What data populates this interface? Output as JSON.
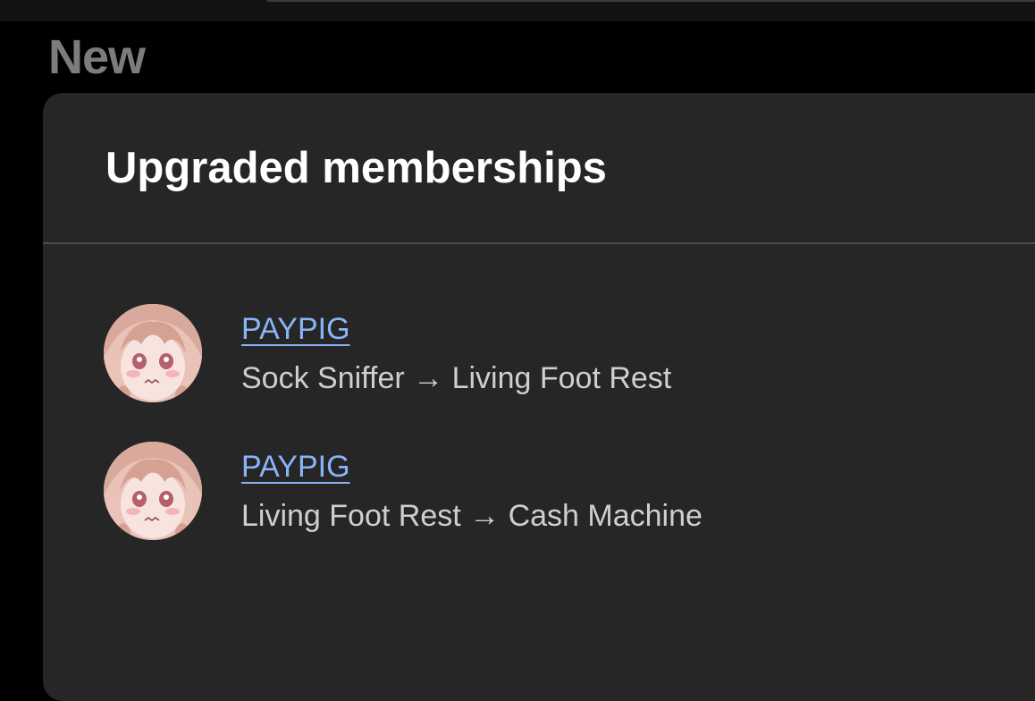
{
  "header": {
    "section_label": "New"
  },
  "card": {
    "title": "Upgraded memberships",
    "items": [
      {
        "name": "PAYPIG",
        "change": "Sock Sniffer → Living Foot Rest",
        "avatar_icon": "anime-avatar"
      },
      {
        "name": "PAYPIG",
        "change": "Living Foot Rest → Cash Machine",
        "avatar_icon": "anime-avatar"
      }
    ]
  },
  "colors": {
    "background": "#000000",
    "card": "#262626",
    "title": "#ffffff",
    "link": "#8ab4f8",
    "secondary_text": "#cfcfcf",
    "section_label": "#7c7c7c"
  }
}
